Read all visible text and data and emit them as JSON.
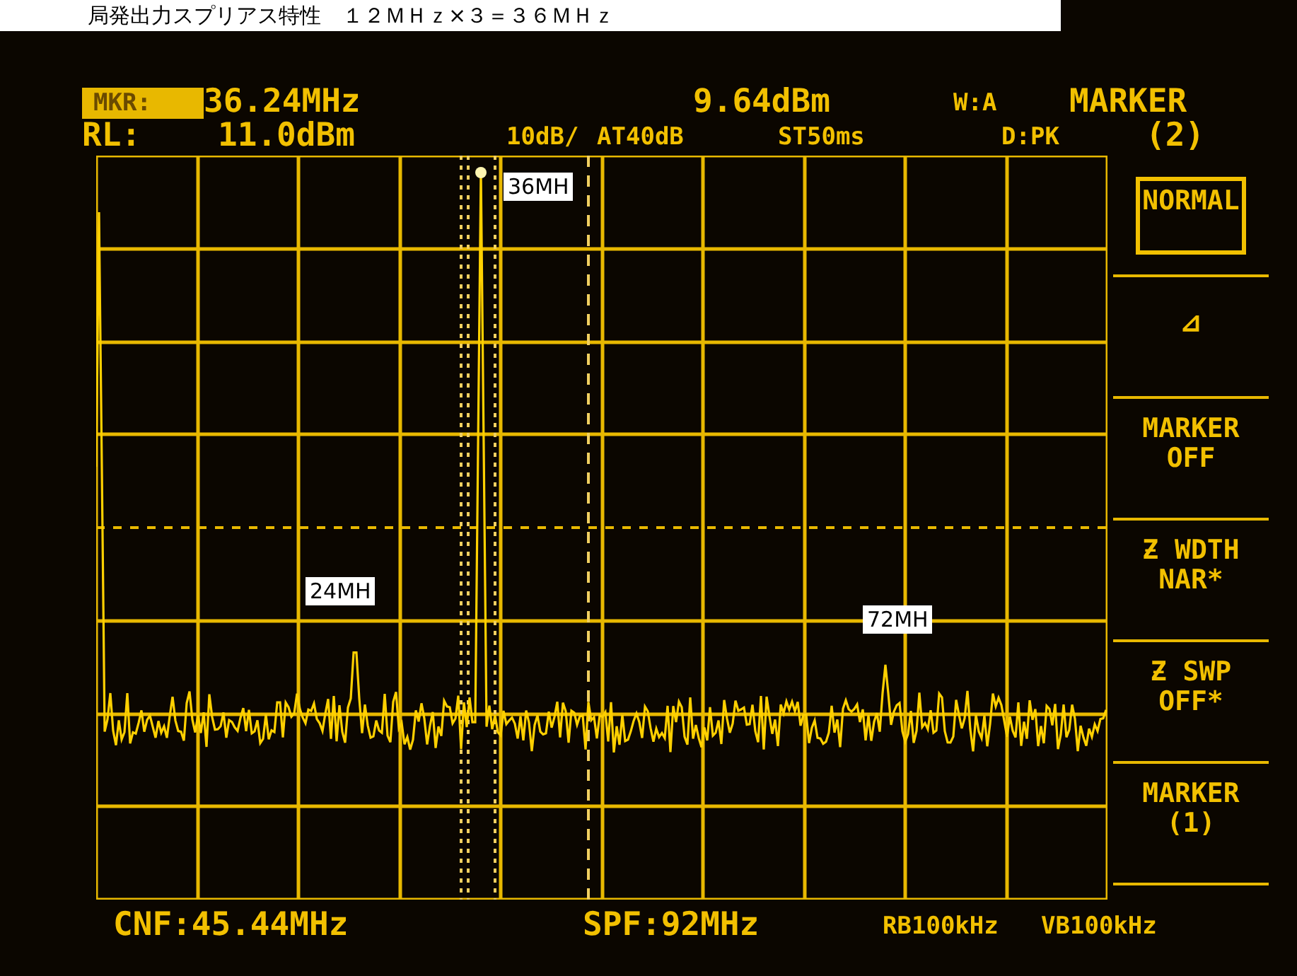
{
  "title": "局発出力スプリアス特性　１２ＭＨｚ×３＝３６ＭＨｚ",
  "header": {
    "marker_label": "MKR:",
    "marker_frequency": "36.24MHz",
    "marker_level": "9.64dBm",
    "trace_mode": "W:A",
    "menu_title": [
      "MARKER",
      "(2)"
    ],
    "ref_label": "RL:",
    "ref_level": "11.0dBm",
    "scale": "10dB/",
    "attenuation": "AT40dB",
    "sweep_time": "ST50ms",
    "detector": "D:PK"
  },
  "peak_labels": [
    {
      "text": "36MH"
    },
    {
      "text": "24MH"
    },
    {
      "text": "72MH"
    }
  ],
  "softkeys": [
    {
      "lines": [
        "NORMAL"
      ],
      "selected": true
    },
    {
      "lines": [
        "⊿"
      ],
      "selected": false
    },
    {
      "lines": [
        "MARKER",
        "OFF"
      ],
      "selected": false
    },
    {
      "lines": [
        "Ƶ WDTH",
        "NAR*"
      ],
      "selected": false
    },
    {
      "lines": [
        "Ƶ SWP",
        "OFF*"
      ],
      "selected": false
    },
    {
      "lines": [
        "MARKER",
        "(1)"
      ],
      "selected": false
    }
  ],
  "footer": {
    "center_frequency": "CNF:45.44MHz",
    "span": "SPF:92MHz",
    "resolution_bandwidth": "RB100kHz",
    "video_bandwidth": "VB100kHz"
  }
}
